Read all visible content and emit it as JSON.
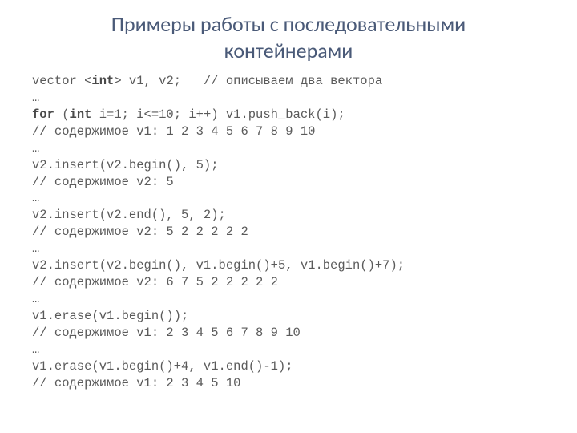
{
  "title": "Примеры работы с последовательными контейнерами",
  "code": [
    {
      "segments": [
        {
          "t": "vector <",
          "b": false
        },
        {
          "t": "int",
          "b": true
        },
        {
          "t": "> v1, v2;   // описываем два вектора",
          "b": false
        }
      ]
    },
    {
      "segments": [
        {
          "t": "…",
          "b": false
        }
      ]
    },
    {
      "segments": [
        {
          "t": "for",
          "b": true
        },
        {
          "t": " (",
          "b": false
        },
        {
          "t": "int",
          "b": true
        },
        {
          "t": " i=1; i<=10; i++) v1.push_back(i);",
          "b": false
        }
      ]
    },
    {
      "segments": [
        {
          "t": "// содержимое v1: 1 2 3 4 5 6 7 8 9 10",
          "b": false
        }
      ]
    },
    {
      "segments": [
        {
          "t": "…",
          "b": false
        }
      ]
    },
    {
      "segments": [
        {
          "t": "v2.insert(v2.begin(), 5);",
          "b": false
        }
      ]
    },
    {
      "segments": [
        {
          "t": "// содержимое v2: 5",
          "b": false
        }
      ]
    },
    {
      "segments": [
        {
          "t": "…",
          "b": false
        }
      ]
    },
    {
      "segments": [
        {
          "t": "v2.insert(v2.end(), 5, 2);",
          "b": false
        }
      ]
    },
    {
      "segments": [
        {
          "t": "// содержимое v2: 5 2 2 2 2 2",
          "b": false
        }
      ]
    },
    {
      "segments": [
        {
          "t": "…",
          "b": false
        }
      ]
    },
    {
      "segments": [
        {
          "t": "v2.insert(v2.begin(), v1.begin()+5, v1.begin()+7);",
          "b": false
        }
      ]
    },
    {
      "segments": [
        {
          "t": "// содержимое v2: 6 7 5 2 2 2 2 2",
          "b": false
        }
      ]
    },
    {
      "segments": [
        {
          "t": "…",
          "b": false
        }
      ]
    },
    {
      "segments": [
        {
          "t": "v1.erase(v1.begin());",
          "b": false
        }
      ]
    },
    {
      "segments": [
        {
          "t": "// содержимое v1: 2 3 4 5 6 7 8 9 10",
          "b": false
        }
      ]
    },
    {
      "segments": [
        {
          "t": "…",
          "b": false
        }
      ]
    },
    {
      "segments": [
        {
          "t": "v1.erase(v1.begin()+4, v1.end()-1);",
          "b": false
        }
      ]
    },
    {
      "segments": [
        {
          "t": "// содержимое v1: 2 3 4 5 10",
          "b": false
        }
      ]
    }
  ]
}
